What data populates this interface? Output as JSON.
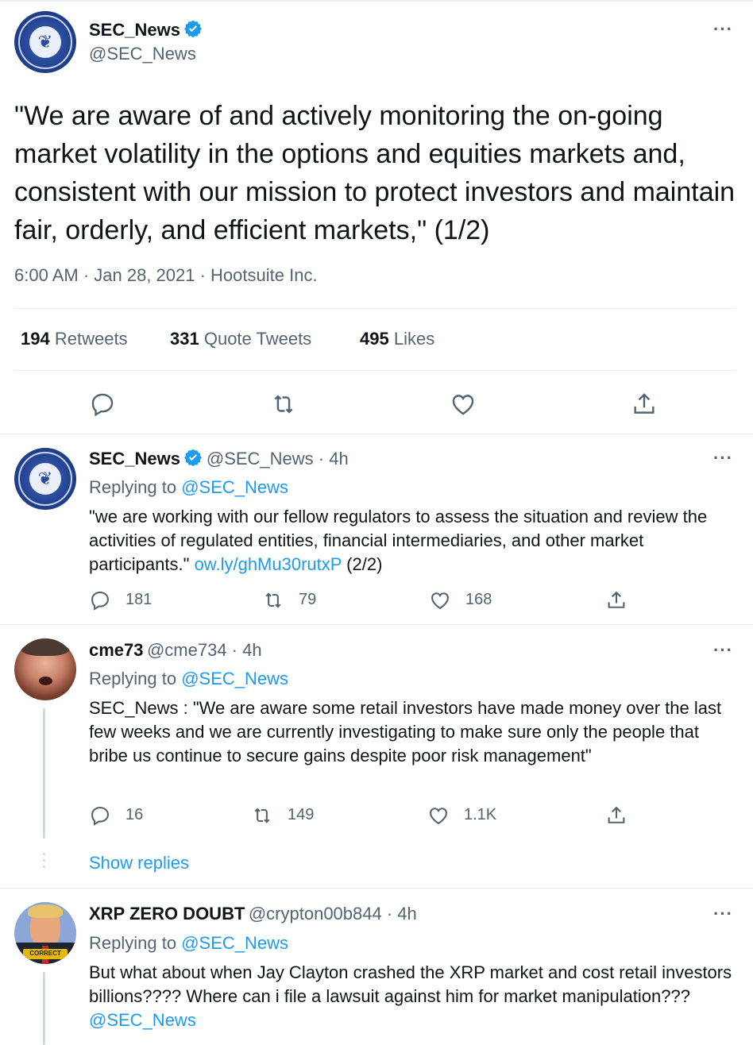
{
  "main_tweet": {
    "display_name": "SEC_News",
    "handle": "@SEC_News",
    "text": "\"We are aware of and actively monitoring the on-going market volatility in the options and equities markets and, consistent with our mission to protect investors and maintain fair, orderly, and efficient markets,\" (1/2)",
    "meta": "6:00 AM · Jan 28, 2021 · Hootsuite Inc.",
    "stats": {
      "retweets_count": "194",
      "retweets_label": "Retweets",
      "quotes_count": "331",
      "quotes_label": "Quote Tweets",
      "likes_count": "495",
      "likes_label": "Likes"
    },
    "more": "···"
  },
  "replies": [
    {
      "display_name": "SEC_News",
      "handle_time": "@SEC_News · 4h",
      "replying_prefix": "Replying to",
      "replying_to": "@SEC_News",
      "text": "\"we are working with our fellow regulators to assess the situation and review the activities of regulated entities, financial intermediaries, and other market participants.\"",
      "link": "ow.ly/ghMu30rutxP",
      "suffix": " (2/2)",
      "reply_count": "181",
      "retweet_count": "79",
      "like_count": "168",
      "more": "···"
    },
    {
      "display_name": "cme73",
      "handle_time": "@cme734 · 4h",
      "replying_prefix": "Replying to",
      "replying_to": "@SEC_News",
      "text": "SEC_News : \"We are aware some retail investors have made money over the last few weeks and we are currently investigating to make sure only the people that bribe us continue to secure gains despite poor risk management\"",
      "reply_count": "16",
      "retweet_count": "149",
      "like_count": "1.1K",
      "show_replies": "Show replies",
      "more": "···"
    },
    {
      "display_name": "XRP ZERO DOUBT",
      "handle_time": "@crypton00b844 · 4h",
      "replying_prefix": "Replying to",
      "replying_to": "@SEC_News",
      "text": "But what about when Jay Clayton crashed the XRP market and cost retail investors billions???? Where can i file a lawsuit against him for market manipulation???",
      "text_mention": "@SEC_News",
      "avatar_badge": "CORRECT",
      "more": "···"
    }
  ],
  "colors": {
    "accent": "#1d9bf0",
    "text": "#0f1419",
    "secondary": "#536471",
    "divider": "#e6ecf0"
  },
  "icons": [
    "verified-badge-icon",
    "more-icon",
    "reply-icon",
    "retweet-icon",
    "like-icon",
    "share-icon"
  ]
}
